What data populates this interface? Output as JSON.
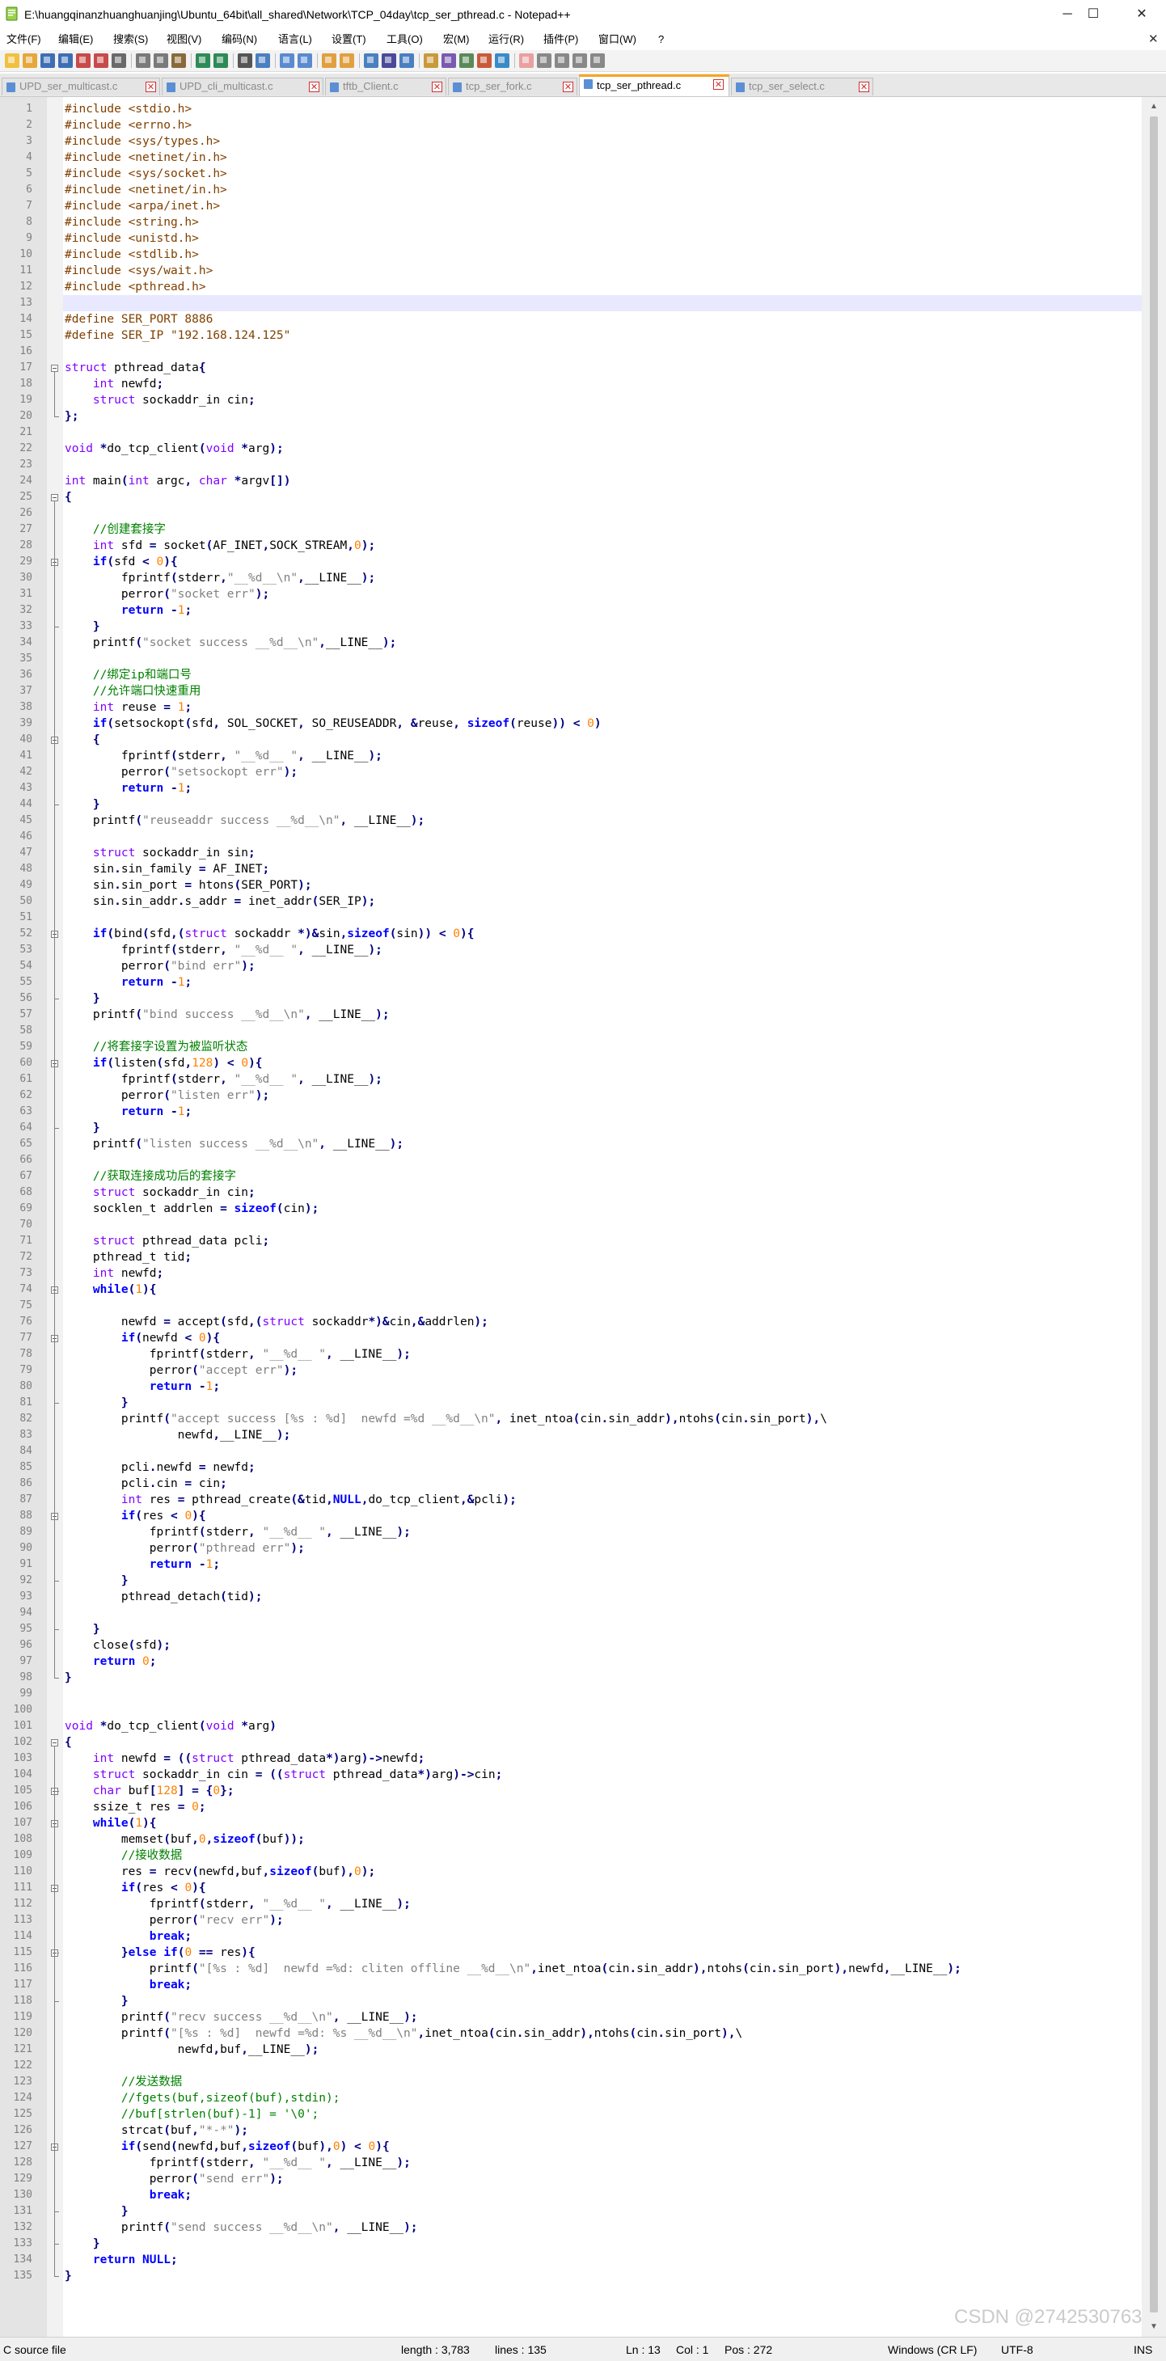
{
  "window": {
    "title": "E:\\huangqinanzhuanghuanjing\\Ubuntu_64bit\\all_shared\\Network\\TCP_04day\\tcp_ser_pthread.c - Notepad++",
    "minimize": "─",
    "maximize": "☐",
    "close": "✕"
  },
  "menu": {
    "items": [
      "文件(F)",
      "编辑(E)",
      "搜索(S)",
      "视图(V)",
      "编码(N)",
      "语言(L)",
      "设置(T)",
      "工具(O)",
      "宏(M)",
      "运行(R)",
      "插件(P)",
      "窗口(W)",
      "?"
    ],
    "close_doc": "✕"
  },
  "tabs": [
    {
      "label": "UPD_ser_multicast.c",
      "active": false
    },
    {
      "label": "UPD_cli_multicast.c",
      "active": false
    },
    {
      "label": "tftb_Client.c",
      "active": false
    },
    {
      "label": "tcp_ser_fork.c",
      "active": false
    },
    {
      "label": "tcp_ser_pthread.c",
      "active": true
    },
    {
      "label": "tcp_ser_select.c",
      "active": false
    }
  ],
  "editor": {
    "current_line": 13,
    "code_lines": [
      "#include <stdio.h>",
      "#include <errno.h>",
      "#include <sys/types.h>",
      "#include <netinet/in.h>",
      "#include <sys/socket.h>",
      "#include <netinet/in.h>",
      "#include <arpa/inet.h>",
      "#include <string.h>",
      "#include <unistd.h>",
      "#include <stdlib.h>",
      "#include <sys/wait.h>",
      "#include <pthread.h>",
      "",
      "#define SER_PORT 8886",
      "#define SER_IP \"192.168.124.125\"",
      "",
      "struct pthread_data{",
      "    int newfd;",
      "    struct sockaddr_in cin;",
      "};",
      "",
      "void *do_tcp_client(void *arg);",
      "",
      "int main(int argc, char *argv[])",
      "{",
      "",
      "    //创建套接字",
      "    int sfd = socket(AF_INET,SOCK_STREAM,0);",
      "    if(sfd < 0){",
      "        fprintf(stderr,\"__%d__\\n\",__LINE__);",
      "        perror(\"socket err\");",
      "        return -1;",
      "    }",
      "    printf(\"socket success __%d__\\n\",__LINE__);",
      "",
      "    //绑定ip和端口号",
      "    //允许端口快速重用",
      "    int reuse = 1;",
      "    if(setsockopt(sfd, SOL_SOCKET, SO_REUSEADDR, &reuse, sizeof(reuse)) < 0)",
      "    {",
      "        fprintf(stderr, \"__%d__ \", __LINE__);",
      "        perror(\"setsockopt err\");",
      "        return -1;",
      "    }",
      "    printf(\"reuseaddr success __%d__\\n\", __LINE__);",
      "",
      "    struct sockaddr_in sin;",
      "    sin.sin_family = AF_INET;",
      "    sin.sin_port = htons(SER_PORT);",
      "    sin.sin_addr.s_addr = inet_addr(SER_IP);",
      "",
      "    if(bind(sfd,(struct sockaddr *)&sin,sizeof(sin)) < 0){",
      "        fprintf(stderr, \"__%d__ \", __LINE__);",
      "        perror(\"bind err\");",
      "        return -1;",
      "    }",
      "    printf(\"bind success __%d__\\n\", __LINE__);",
      "",
      "    //将套接字设置为被监听状态",
      "    if(listen(sfd,128) < 0){",
      "        fprintf(stderr, \"__%d__ \", __LINE__);",
      "        perror(\"listen err\");",
      "        return -1;",
      "    }",
      "    printf(\"listen success __%d__\\n\", __LINE__);",
      "",
      "    //获取连接成功后的套接字",
      "    struct sockaddr_in cin;",
      "    socklen_t addrlen = sizeof(cin);",
      "",
      "    struct pthread_data pcli;",
      "    pthread_t tid;",
      "    int newfd;",
      "    while(1){",
      "",
      "        newfd = accept(sfd,(struct sockaddr*)&cin,&addrlen);",
      "        if(newfd < 0){",
      "            fprintf(stderr, \"__%d__ \", __LINE__);",
      "            perror(\"accept err\");",
      "            return -1;",
      "        }",
      "        printf(\"accept success [%s : %d]  newfd =%d __%d__\\n\", inet_ntoa(cin.sin_addr),ntohs(cin.sin_port),\\",
      "                newfd,__LINE__);",
      "",
      "        pcli.newfd = newfd;",
      "        pcli.cin = cin;",
      "        int res = pthread_create(&tid,NULL,do_tcp_client,&pcli);",
      "        if(res < 0){",
      "            fprintf(stderr, \"__%d__ \", __LINE__);",
      "            perror(\"pthread err\");",
      "            return -1;",
      "        }",
      "        pthread_detach(tid);",
      "",
      "    }",
      "    close(sfd);",
      "    return 0;",
      "}",
      "",
      "",
      "void *do_tcp_client(void *arg)",
      "{",
      "    int newfd = ((struct pthread_data*)arg)->newfd;",
      "    struct sockaddr_in cin = ((struct pthread_data*)arg)->cin;",
      "    char buf[128] = {0};",
      "    ssize_t res = 0;",
      "    while(1){",
      "        memset(buf,0,sizeof(buf));",
      "        //接收数据",
      "        res = recv(newfd,buf,sizeof(buf),0);",
      "        if(res < 0){",
      "            fprintf(stderr, \"__%d__ \", __LINE__);",
      "            perror(\"recv err\");",
      "            break;",
      "        }else if(0 == res){",
      "            printf(\"[%s : %d]  newfd =%d: cliten offline __%d__\\n\",inet_ntoa(cin.sin_addr),ntohs(cin.sin_port),newfd,__LINE__);",
      "            break;",
      "        }",
      "        printf(\"recv success __%d__\\n\", __LINE__);",
      "        printf(\"[%s : %d]  newfd =%d: %s __%d__\\n\",inet_ntoa(cin.sin_addr),ntohs(cin.sin_port),\\",
      "                newfd,buf,__LINE__);",
      "",
      "        //发送数据",
      "        //fgets(buf,sizeof(buf),stdin);",
      "        //buf[strlen(buf)-1] = '\\0';",
      "        strcat(buf,\"*-*\");",
      "        if(send(newfd,buf,sizeof(buf),0) < 0){",
      "            fprintf(stderr, \"__%d__ \", __LINE__);",
      "            perror(\"send err\");",
      "            break;",
      "        }",
      "        printf(\"send success __%d__\\n\", __LINE__);",
      "    }",
      "    return NULL;",
      "}"
    ]
  },
  "statusbar": {
    "language": "C source file",
    "length": "length : 3,783",
    "lines": "lines : 135",
    "ln": "Ln : 13",
    "col": "Col : 1",
    "pos": "Pos : 272",
    "eol": "Windows (CR LF)",
    "encoding": "UTF-8",
    "mode": "INS"
  },
  "watermark": "CSDN @2742530763",
  "colors": {
    "keyword": "#8000ff",
    "type": "#8000ff",
    "number": "#ff8000",
    "string": "#808080",
    "preproc": "#804000",
    "comment": "#008000",
    "operator": "#000080",
    "bold_keyword": "#0000ff",
    "tab_accent": "#f5a623",
    "current_line": "#e8e8ff"
  }
}
